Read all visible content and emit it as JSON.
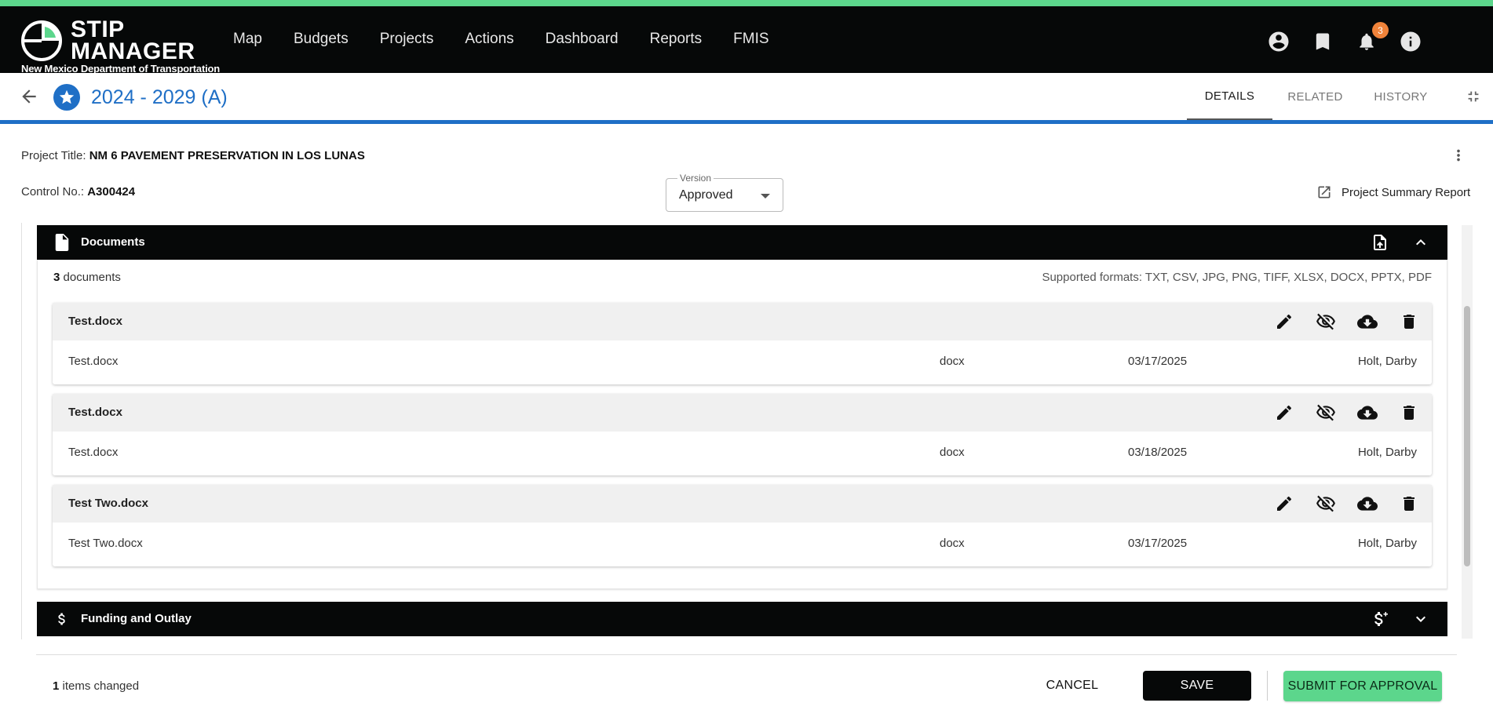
{
  "app": {
    "logo_line1": "STIP",
    "logo_line2": "MANAGER",
    "logo_subtitle": "New Mexico Department of Transportation",
    "accent_color": "#5cd68c",
    "brand_blue": "#1f6fc6"
  },
  "nav": {
    "items": [
      {
        "label": "Map"
      },
      {
        "label": "Budgets"
      },
      {
        "label": "Projects"
      },
      {
        "label": "Actions"
      },
      {
        "label": "Dashboard"
      },
      {
        "label": "Reports"
      },
      {
        "label": "FMIS"
      }
    ],
    "icons": [
      "account-circle-icon",
      "bookmark-icon",
      "bell-icon",
      "info-icon"
    ],
    "notification_count": "3"
  },
  "subheader": {
    "title": "2024 - 2029 (A)",
    "tabs": [
      {
        "label": "DETAILS",
        "active": true
      },
      {
        "label": "RELATED",
        "active": false
      },
      {
        "label": "HISTORY",
        "active": false
      }
    ]
  },
  "project": {
    "title_label": "Project Title:",
    "title_value": "NM 6 PAVEMENT PRESERVATION IN LOS LUNAS",
    "control_label": "Control No.:",
    "control_value": "A300424",
    "version_label": "Version",
    "version_value": "Approved",
    "summary_report_label": "Project Summary Report"
  },
  "documents": {
    "section_title": "Documents",
    "count": "3",
    "count_suffix": "documents",
    "formats": "Supported formats: TXT, CSV, JPG, PNG, TIFF, XLSX, DOCX, PPTX, PDF",
    "items": [
      {
        "name": "Test.docx",
        "filename": "Test.docx",
        "type": "docx",
        "date": "03/17/2025",
        "user": "Holt, Darby"
      },
      {
        "name": "Test.docx",
        "filename": "Test.docx",
        "type": "docx",
        "date": "03/18/2025",
        "user": "Holt, Darby"
      },
      {
        "name": "Test Two.docx",
        "filename": "Test Two.docx",
        "type": "docx",
        "date": "03/17/2025",
        "user": "Holt, Darby"
      }
    ]
  },
  "funding": {
    "section_title": "Funding and Outlay"
  },
  "footer": {
    "changed_count": "1",
    "changed_suffix": "items changed",
    "cancel_label": "CANCEL",
    "save_label": "SAVE",
    "submit_label": "SUBMIT FOR APPROVAL"
  }
}
